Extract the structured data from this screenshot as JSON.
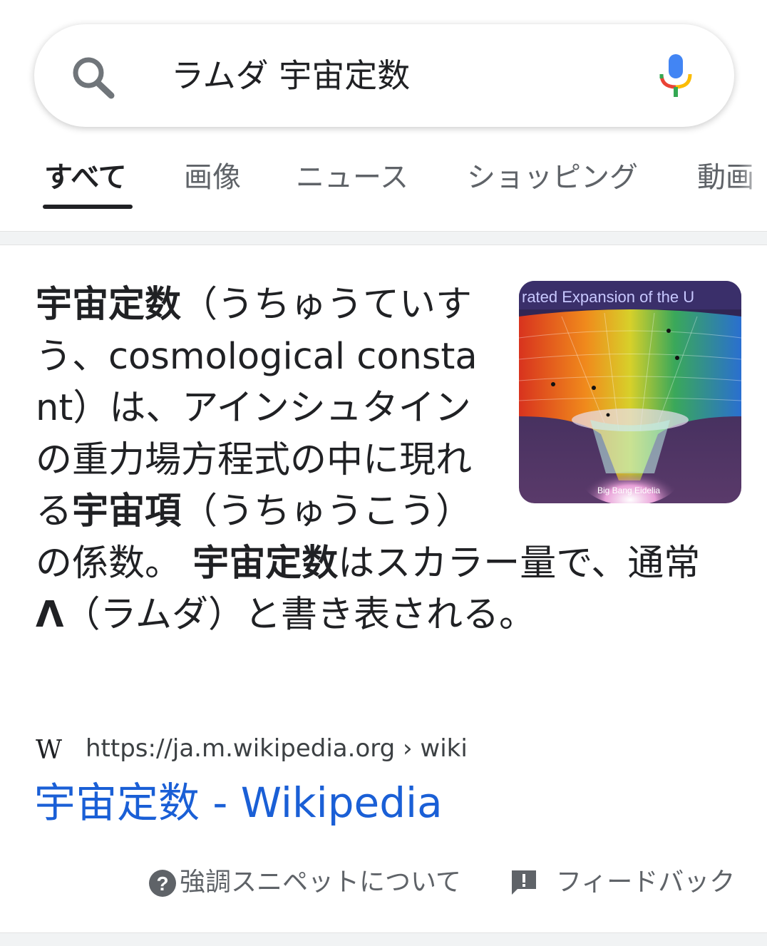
{
  "search": {
    "query": "ラムダ 宇宙定数"
  },
  "tabs": [
    {
      "label": "すべて"
    },
    {
      "label": "画像"
    },
    {
      "label": "ニュース"
    },
    {
      "label": "ショッピング"
    },
    {
      "label": "動画"
    }
  ],
  "snippet": {
    "part1_bold": "宇宙定数",
    "part2": "（うちゅうていすう、cosmological constant）は、アインシュタインの重力場方程式の中に現れる",
    "part3_bold": "宇宙項",
    "part4": "（うちゅうこう）の係数。 ",
    "part5_bold": "宇宙定数",
    "part6": "はスカラー量で、通常",
    "part7_bold": "Λ",
    "part8": "（ラムダ）と書き表される。",
    "image_caption_top": "rated Expansion of the U",
    "image_caption_bottom": "Big Bang Eidelia"
  },
  "source": {
    "logo": "W",
    "url": "https://ja.m.wikipedia.org › wiki"
  },
  "result": {
    "title": "宇宙定数 - Wikipedia"
  },
  "footer": {
    "about_label": "強調スニペットについて",
    "feedback_label": "フィードバック"
  },
  "colors": {
    "link": "#1a5fd6",
    "text": "#202124",
    "muted": "#5f6368"
  }
}
